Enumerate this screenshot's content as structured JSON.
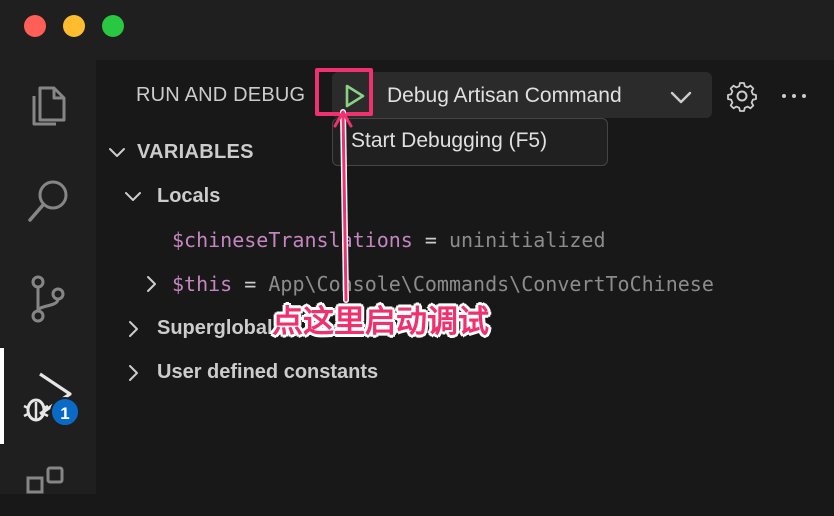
{
  "window": {
    "traffic_lights": {
      "close": "#ff5f57",
      "minimize": "#febc2e",
      "maximize": "#28c840"
    }
  },
  "activity_bar": {
    "items": [
      {
        "name": "explorer",
        "icon": "files-icon"
      },
      {
        "name": "search",
        "icon": "search-icon"
      },
      {
        "name": "source-control",
        "icon": "source-control-icon"
      },
      {
        "name": "run-and-debug",
        "icon": "debug-icon",
        "badge": "1",
        "active": true
      },
      {
        "name": "extensions",
        "icon": "extensions-icon"
      }
    ]
  },
  "panel": {
    "title": "RUN AND DEBUG",
    "configuration": "Debug Artisan Command",
    "start_tooltip": "Start Debugging (F5)"
  },
  "variables": {
    "section_title": "VARIABLES",
    "locals_label": "Locals",
    "locals": [
      {
        "name": "$chineseTranslations",
        "eq": "=",
        "value": "uninitialized"
      },
      {
        "name": "$this",
        "eq": "=",
        "value": "App\\Console\\Commands\\ConvertToChinese"
      }
    ],
    "superglobals_label": "Superglobals",
    "user_constants_label": "User defined constants"
  },
  "annotation": {
    "text": "点这里启动调试",
    "color": "#f0316f"
  }
}
